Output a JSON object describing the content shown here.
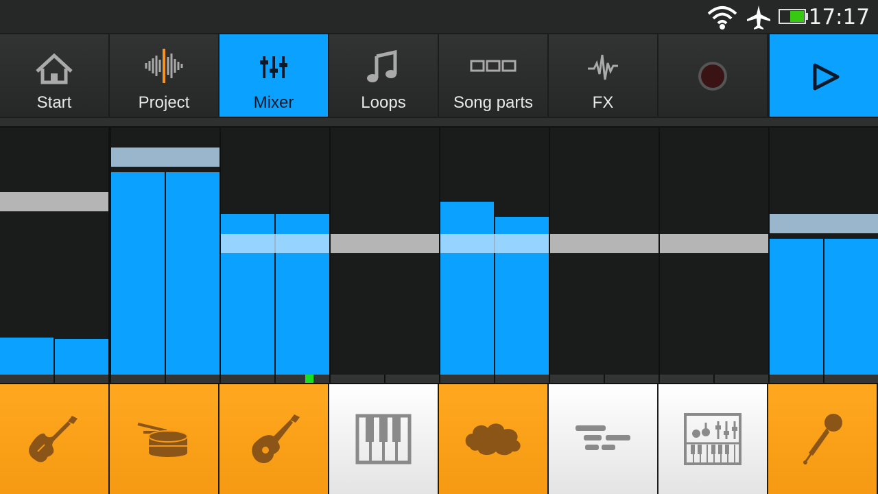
{
  "status_bar": {
    "time": "17:17",
    "icons": [
      "wifi-icon",
      "airplane-mode-icon",
      "battery-icon"
    ],
    "battery_color": "#37c812"
  },
  "nav": {
    "active_tab": "Mixer",
    "accent_color": "#0aa1ff",
    "tabs": [
      {
        "label": "Start",
        "icon": "home-icon"
      },
      {
        "label": "Project",
        "icon": "waveform-icon"
      },
      {
        "label": "Mixer",
        "icon": "mixer-sliders-icon"
      },
      {
        "label": "Loops",
        "icon": "music-note-icon"
      },
      {
        "label": "Song parts",
        "icon": "song-parts-icon"
      },
      {
        "label": "FX",
        "icon": "fx-wave-icon"
      }
    ],
    "record_icon": "record-icon",
    "play_icon": "play-icon"
  },
  "mixer": {
    "level_scale": "fraction of channel height",
    "meter_color": "#0aa1ff",
    "channels": [
      {
        "meter_left": 0.15,
        "meter_right": 0.145,
        "fader": 0.7,
        "pan": null
      },
      {
        "meter_left": 0.82,
        "meter_right": 0.82,
        "fader": 0.88,
        "pan": null
      },
      {
        "meter_left": 0.65,
        "meter_right": 0.65,
        "fader": 0.53,
        "pan": 0.78
      },
      {
        "meter_left": 0,
        "meter_right": 0,
        "fader": 0.53,
        "pan": null
      },
      {
        "meter_left": 0.7,
        "meter_right": 0.64,
        "fader": 0.53,
        "pan": null
      },
      {
        "meter_left": 0,
        "meter_right": 0,
        "fader": 0.53,
        "pan": null
      },
      {
        "meter_left": 0,
        "meter_right": 0,
        "fader": 0.53,
        "pan": null
      },
      {
        "meter_left": 0.55,
        "meter_right": 0.55,
        "fader": 0.61,
        "pan": null
      }
    ]
  },
  "instruments": [
    {
      "icon": "electric-guitar-icon",
      "style": "orange"
    },
    {
      "icon": "drum-icon",
      "style": "orange"
    },
    {
      "icon": "acoustic-guitar-icon",
      "style": "orange"
    },
    {
      "icon": "piano-keys-icon",
      "style": "white"
    },
    {
      "icon": "cloud-icon",
      "style": "orange"
    },
    {
      "icon": "sequencer-icon",
      "style": "white"
    },
    {
      "icon": "synthesizer-icon",
      "style": "white"
    },
    {
      "icon": "microphone-icon",
      "style": "orange"
    }
  ]
}
